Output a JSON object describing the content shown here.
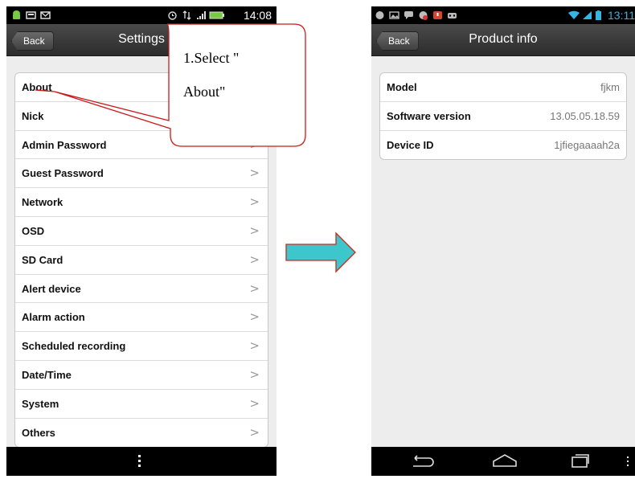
{
  "left_screen": {
    "status_time": "14:08",
    "back_label": "Back",
    "title": "Settings",
    "items": [
      {
        "label": "About"
      },
      {
        "label": "Nick"
      },
      {
        "label": "Admin Password"
      },
      {
        "label": "Guest Password"
      },
      {
        "label": "Network"
      },
      {
        "label": "OSD"
      },
      {
        "label": "SD Card"
      },
      {
        "label": "Alert device"
      },
      {
        "label": "Alarm action"
      },
      {
        "label": "Scheduled recording"
      },
      {
        "label": "Date/Time"
      },
      {
        "label": "System"
      },
      {
        "label": "Others"
      }
    ],
    "chevron": ">"
  },
  "callout": {
    "line1": "1.Select \"",
    "line2": "About\""
  },
  "right_screen": {
    "status_time": "13:11",
    "back_label": "Back",
    "title": "Product info",
    "rows": [
      {
        "label": "Model",
        "value": "fjkm"
      },
      {
        "label": "Software version",
        "value": "13.05.05.18.59"
      },
      {
        "label": "Device ID",
        "value": "1jfiegaaaah2a"
      }
    ]
  },
  "colors": {
    "arrow_fill": "#3dc6cc",
    "arrow_stroke": "#cc2a1a",
    "callout_stroke": "#cc1a1a",
    "status_accent": "#33b5e5"
  }
}
